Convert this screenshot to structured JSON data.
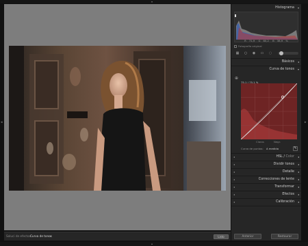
{
  "bottom_toolbar": {
    "label": "Soluci de efectos:",
    "value": "Curva de tonos",
    "button": "Listo"
  },
  "panel": {
    "histogram_title": "Histograma",
    "hist_values": [
      "R",
      "71,9",
      "G",
      "60,2",
      "B",
      "38,9",
      "%"
    ],
    "original_photo_label": "Fotografía original",
    "basic_title": "Básicos",
    "tone_curve_title": "Curva de tonos",
    "curve_readout": "75,1 / 75,1 %",
    "curve_label_left": "Claros",
    "curve_label_right": "Negr.",
    "point_curve_label": "Curva de puntos:",
    "point_curve_value": "A medida",
    "hsl_title_a": "HSL",
    "hsl_title_b": "Color",
    "split_toning_title": "Dividir tonos",
    "detail_title": "Detalle",
    "lens_corrections_title": "Correcciones de lente",
    "transform_title": "Transformar",
    "effects_title": "Efectos",
    "calibration_title": "Calibración"
  },
  "footer": {
    "previous_label": "Anterior",
    "reset_label": "Restaurar"
  },
  "icons": {
    "expand": "triangle-down",
    "collapse": "triangle-left",
    "target": "target-adjust",
    "eyedropper": "eyedropper"
  },
  "colors": {
    "panel_bg": "#262626",
    "viewport_bg": "#7d7d7d",
    "curve_bg": "#8a2a2a",
    "histogram_highlight": "#ffffff"
  }
}
